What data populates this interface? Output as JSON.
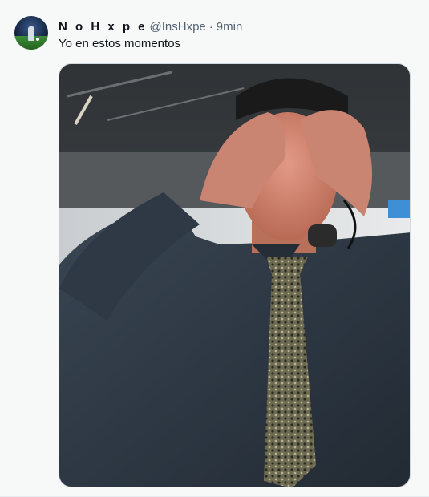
{
  "tweet": {
    "display_name": "N o H x p e",
    "handle": "@InsHxpe",
    "separator": "·",
    "time": "9min",
    "text": "Yo en estos momentos"
  },
  "icons": {
    "avatar": "avatar-image",
    "media": "photo-image"
  },
  "colors": {
    "text_primary": "#0f1419",
    "text_secondary": "#536471",
    "background": "#f7f9f9"
  }
}
